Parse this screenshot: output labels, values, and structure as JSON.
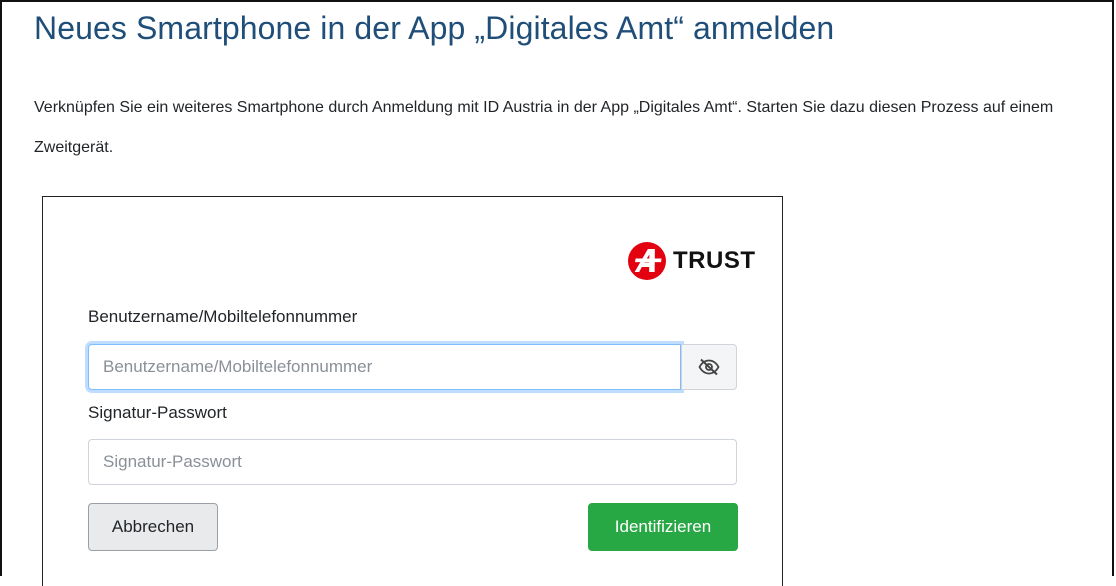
{
  "page": {
    "heading": "Neues Smartphone in der App „Digitales Amt“ anmelden",
    "intro": "Verknüpfen Sie ein weiteres Smartphone durch Anmeldung mit ID Austria in der App „Digitales Amt“. Starten Sie dazu diesen Prozess auf einem Zweitgerät."
  },
  "login": {
    "logo_text": "TRUST",
    "logo_color": "#e3000f",
    "username_label": "Benutzername/Mobiltelefonnummer",
    "username_placeholder": "Benutzername/Mobiltelefonnummer",
    "username_value": "",
    "password_label": "Signatur-Passwort",
    "password_placeholder": "Signatur-Passwort",
    "password_value": "",
    "toggle_icon": "eye-slash-icon",
    "cancel_label": "Abbrechen",
    "submit_label": "Identifizieren",
    "submit_color": "#28a745"
  }
}
